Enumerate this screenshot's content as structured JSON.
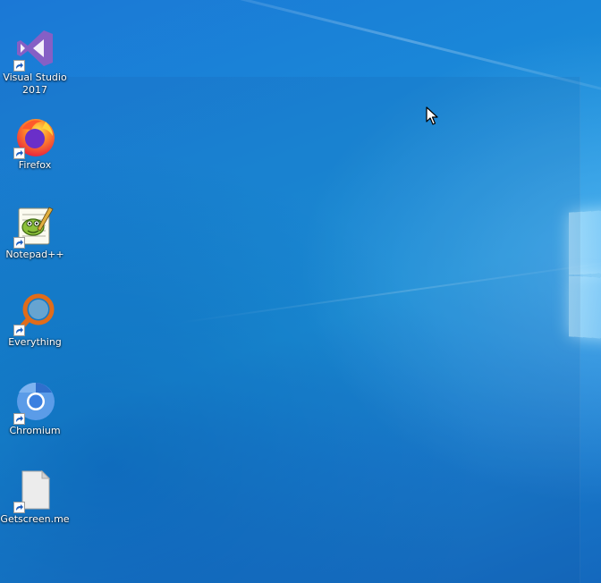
{
  "desktop": {
    "icons": [
      {
        "label": "Visual Studio\n2017",
        "icon": "visual-studio-icon",
        "color": "#865fc5"
      },
      {
        "label": "Firefox",
        "icon": "firefox-icon",
        "color": "#ff7139"
      },
      {
        "label": "Notepad++",
        "icon": "notepad-plus-plus-icon",
        "color": "#90c040"
      },
      {
        "label": "Everything",
        "icon": "everything-search-icon",
        "color": "#e06c1a"
      },
      {
        "label": "Chromium",
        "icon": "chromium-icon",
        "color": "#4a8fe0"
      },
      {
        "label": "Getscreen.me",
        "icon": "generic-file-icon",
        "color": "#e8e8e8"
      }
    ],
    "background_accent": "#1a8ad8",
    "shortcut_overlay": "shortcut-arrow-icon",
    "cursor": "mouse-pointer-icon"
  }
}
